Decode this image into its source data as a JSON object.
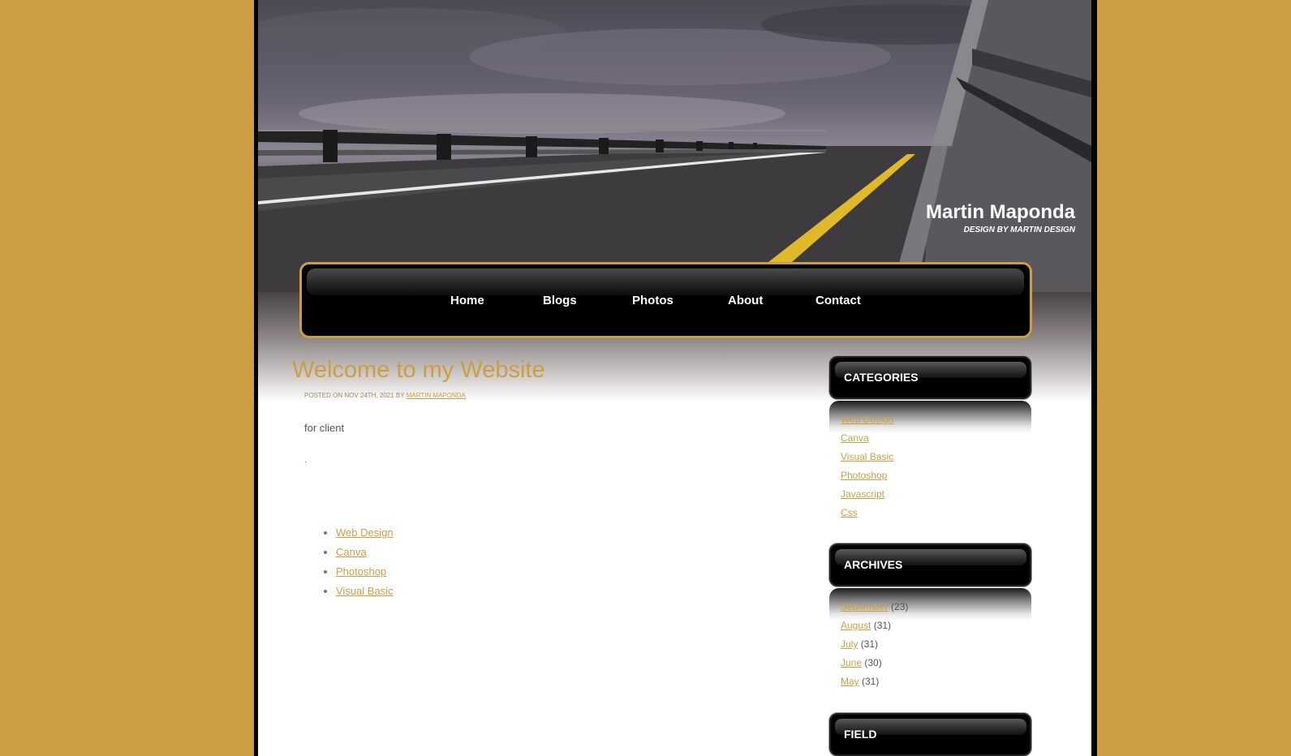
{
  "colors": {
    "background": "#cc9e44",
    "accent": "#cc9e44",
    "nav_bg": "#000000"
  },
  "header": {
    "site_title": "Martin Maponda",
    "site_subtitle": "DESIGN BY MARTIN DESIGN",
    "image": "bridge-road-photo"
  },
  "nav": {
    "items": [
      {
        "label": "Home"
      },
      {
        "label": "Blogs"
      },
      {
        "label": "Photos"
      },
      {
        "label": "About"
      },
      {
        "label": "Contact"
      }
    ]
  },
  "post": {
    "title": "Welcome to my Website",
    "meta_prefix": "POSTED ON NOV 24TH, 2021 BY",
    "author": "MARTIN MAPONDA",
    "body": "for client",
    "dot": ".",
    "links": [
      "Web Design",
      "Canva",
      "Photoshop",
      "Visual Basic"
    ]
  },
  "sidebar": {
    "categories": {
      "title": "CATEGORIES",
      "items": [
        "Web Design",
        "Canva",
        "Visual Basic",
        "Photoshop",
        "Javascript",
        "Css"
      ]
    },
    "archives": {
      "title": "ARCHIVES",
      "items": [
        {
          "month": "September",
          "count": "(23)"
        },
        {
          "month": "August",
          "count": "(31)"
        },
        {
          "month": "July",
          "count": "(31)"
        },
        {
          "month": "June",
          "count": "(30)"
        },
        {
          "month": "May",
          "count": "(31)"
        }
      ]
    },
    "field": {
      "title": "FIELD"
    }
  }
}
